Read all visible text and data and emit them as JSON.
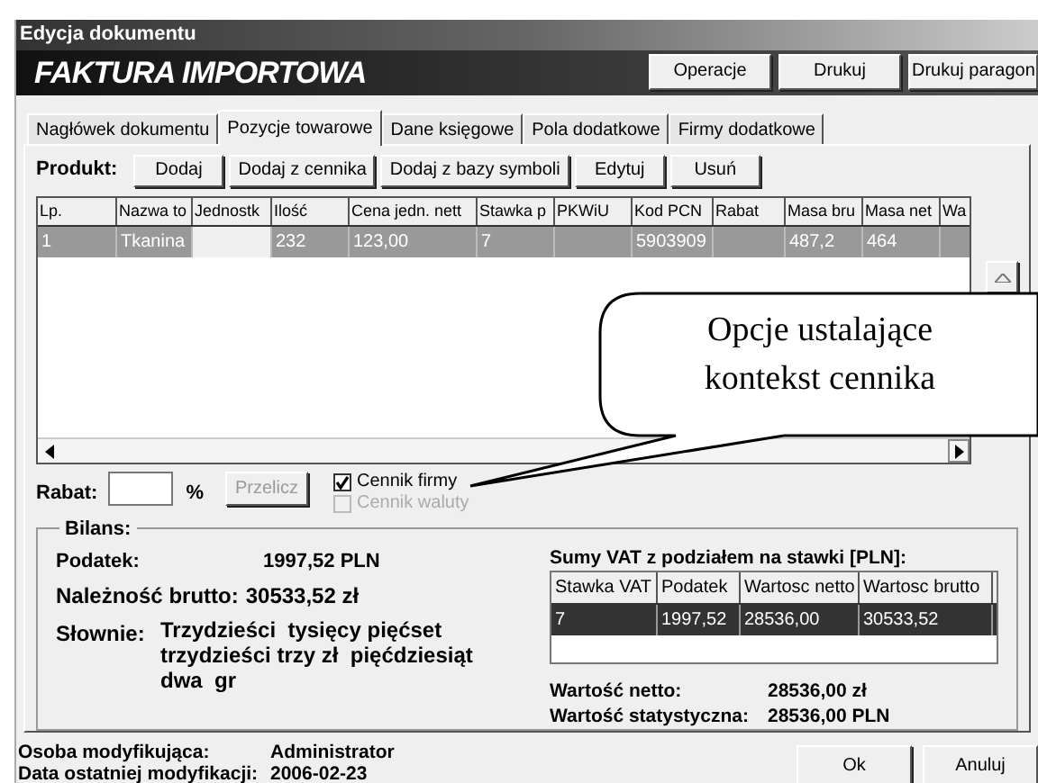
{
  "window": {
    "title": "Edycja dokumentu"
  },
  "header": {
    "title": "FAKTURA IMPORTOWA",
    "buttons": [
      "Operacje",
      "Drukuj",
      "Drukuj paragon"
    ]
  },
  "tabs": [
    {
      "label": "Nagłówek dokumentu",
      "selected": false
    },
    {
      "label": "Pozycje towarowe",
      "selected": true
    },
    {
      "label": "Dane księgowe",
      "selected": false
    },
    {
      "label": "Pola dodatkowe",
      "selected": false
    },
    {
      "label": "Firmy dodatkowe",
      "selected": false
    }
  ],
  "product_toolbar": {
    "label": "Produkt:",
    "buttons": [
      "Dodaj",
      "Dodaj z cennika",
      "Dodaj z bazy symboli",
      "Edytuj",
      "Usuń"
    ]
  },
  "table": {
    "columns": [
      "Lp.",
      "Nazwa to",
      "Jednostk",
      "Ilość",
      "Cena jedn. nett",
      "Stawka p",
      "PKWiU",
      "Kod PCN",
      "Rabat",
      "Masa bru",
      "Masa net",
      "Wa"
    ],
    "rows": [
      {
        "selected": true,
        "cells": [
          "1",
          "Tkanina",
          "",
          "232",
          "123,00",
          "7",
          "",
          "5903909",
          "",
          "487,2",
          "464",
          ""
        ]
      }
    ]
  },
  "callout": {
    "text": "Opcje ustalające kontekst cennika"
  },
  "discount": {
    "label": "Rabat:",
    "unit": "%",
    "button": {
      "label": "Przelicz",
      "disabled": true
    }
  },
  "checkboxes": [
    {
      "label": "Cennik firmy",
      "checked": true,
      "disabled": false
    },
    {
      "label": "Cennik waluty",
      "checked": false,
      "disabled": true
    }
  ],
  "balance": {
    "title": "Bilans:",
    "tax_label": "Podatek:",
    "tax_value": "1997,52 PLN",
    "gross_label": "Należność brutto:",
    "gross_value": "30533,52 zł",
    "words_label": "Słownie:",
    "words_value": "Trzydzieści  tysięcy pięćset trzydzieści trzy zł  pięćdziesiąt dwa  gr",
    "vat_title": "Sumy VAT z podziałem na stawki [PLN]:",
    "vat_columns": [
      "Stawka VAT",
      "Podatek",
      "Wartosc netto",
      "Wartosc brutto"
    ],
    "vat_rows": [
      {
        "selected": true,
        "cells": [
          "7",
          "1997,52",
          "28536,00",
          "30533,52"
        ]
      }
    ],
    "net_label": "Wartość netto:",
    "net_value": "28536,00 zł",
    "stat_label": "Wartość statystyczna:",
    "stat_value": "28536,00 PLN"
  },
  "footer": {
    "modifier_label": "Osoba modyfikująca:",
    "modifier_value": "Administrator",
    "date_label": "Data ostatniej modyfikacji:",
    "date_value": "2006-02-23",
    "buttons": [
      "Ok",
      "Anuluj"
    ]
  }
}
